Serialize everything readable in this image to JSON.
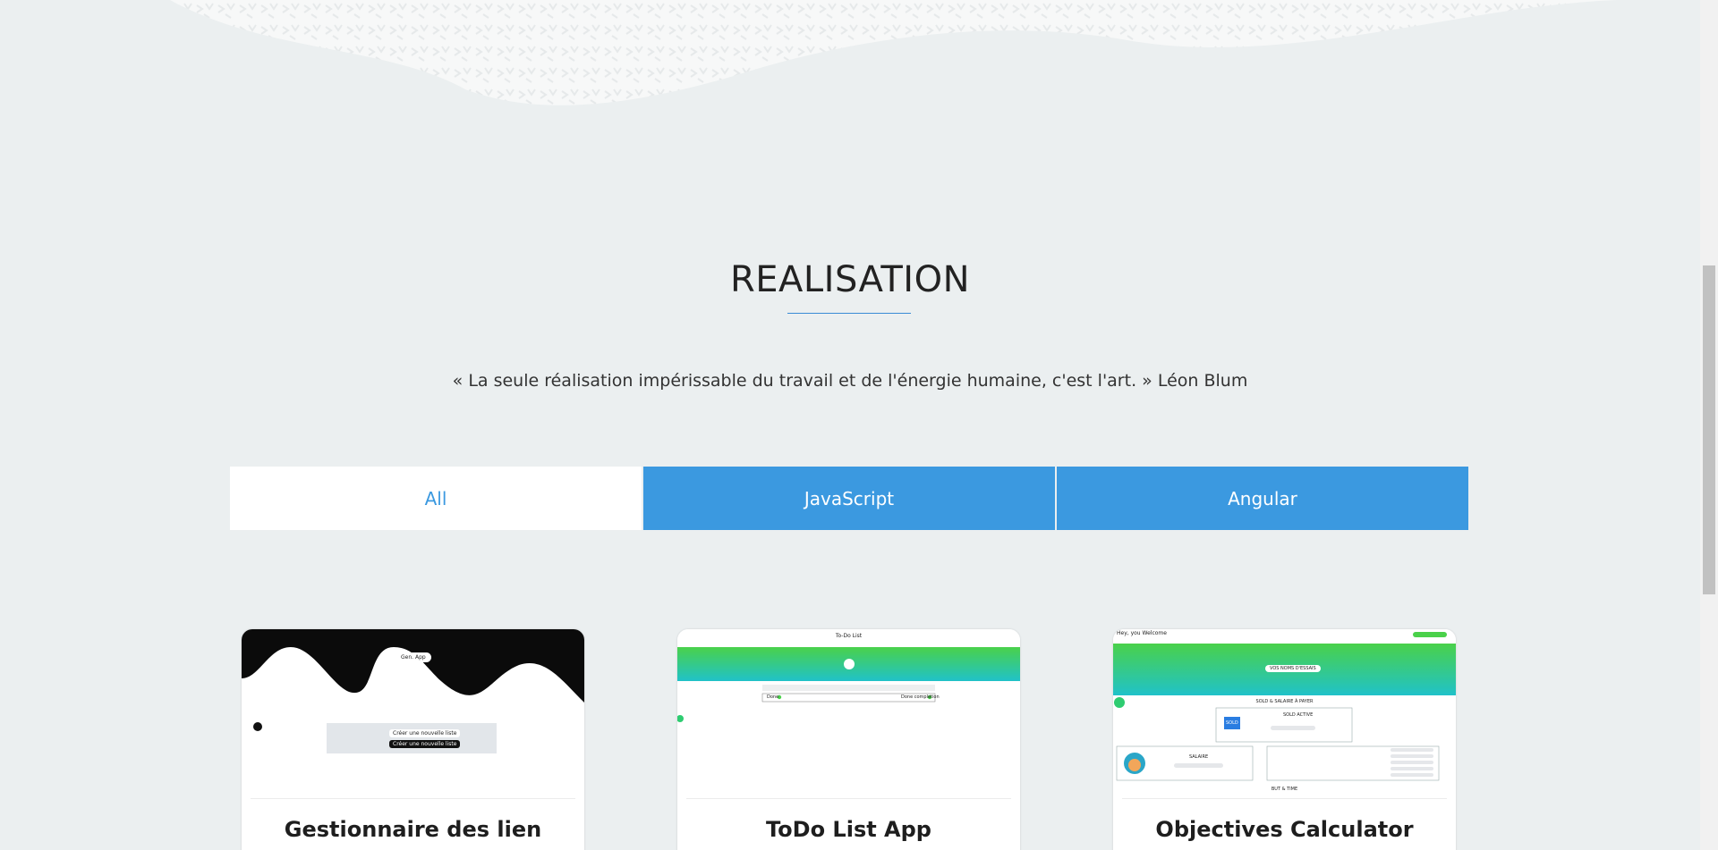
{
  "section": {
    "title": "REALISATION",
    "quote": "« La seule réalisation impérissable du travail et de l'énergie humaine, c'est l'art. » Léon Blum"
  },
  "tabs": [
    {
      "label": "All",
      "active": true
    },
    {
      "label": "JavaScript",
      "active": false
    },
    {
      "label": "Angular",
      "active": false
    }
  ],
  "projects": [
    {
      "title": "Gestionnaire des lien",
      "preview": {
        "pill": "Gen. App",
        "line1": "Créer une nouvelle liste",
        "line2": "Créer une nouvelle liste"
      }
    },
    {
      "title": "ToDo List App",
      "preview": {
        "header": "To-Do List",
        "left": "Done",
        "right": "Done completion"
      }
    },
    {
      "title": "Objectives Calculator",
      "preview": {
        "header": "Hey, you Welcome",
        "pill": "VOS NOMS D'ESSAIS",
        "section": "SOLD & SALAIRE À PAYER",
        "box": "SOLD ACTIVE",
        "badge": "SOLD",
        "salary": "SALAIRE",
        "bottom": "BUT & TIME"
      }
    }
  ],
  "colors": {
    "accent": "#3b99e0",
    "background": "#ebeff0"
  }
}
